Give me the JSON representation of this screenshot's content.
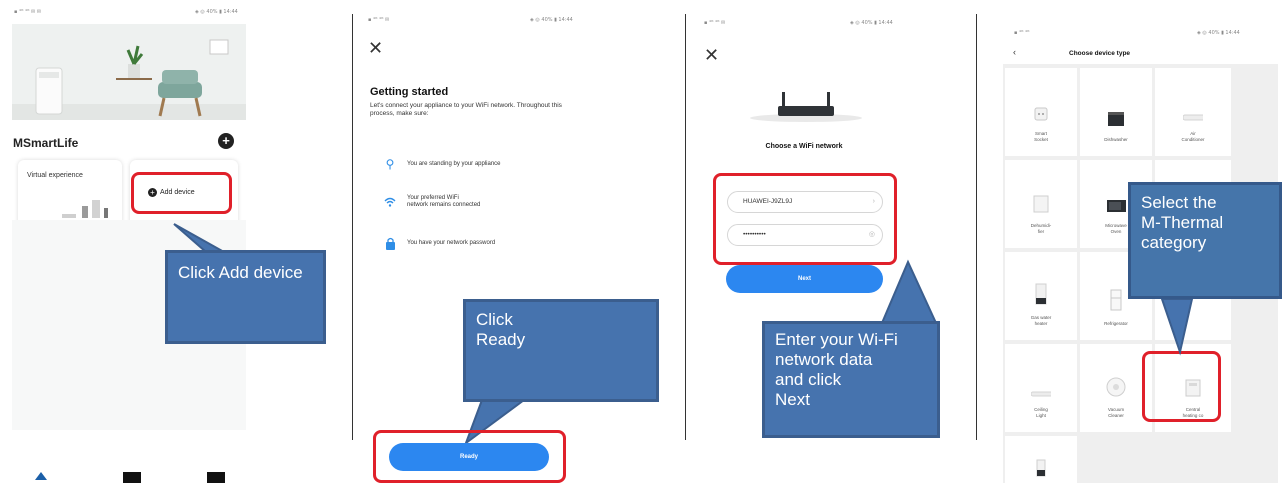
{
  "screen1": {
    "status_left": "▪ ⁴ᴳ ⁴ᴳ ✉ ✉",
    "status_right": "◈ ◎ 40% ▮ 14:44",
    "brand": "MSmartLife",
    "card_virtual": "Virtual experience",
    "add_device": "Add device",
    "callout": "Click Add device"
  },
  "screen2": {
    "status_left": "▪ ⁴ᴳ ⁴ᴳ ✉",
    "status_right": "◈ ◎ 40% ▮ 14:44",
    "close": "✕",
    "title": "Getting started",
    "description": "Let's connect your appliance to your WiFi network. Throughout this process, make sure:",
    "items": [
      {
        "icon": "person-pin-icon",
        "text": "You are standing by your appliance"
      },
      {
        "icon": "wifi-icon",
        "text": "Your preferred WiFi\nnetwork remains connected"
      },
      {
        "icon": "lock-icon",
        "text": "You have your network password"
      }
    ],
    "ready_button": "Ready",
    "callout": "Click\nReady"
  },
  "screen3": {
    "status_left": "▪ ⁴ᴳ ⁴ᴳ ✉",
    "status_right": "◈ ◎ 40% ▮ 14:44",
    "close": "✕",
    "title": "Choose a WiFi network",
    "network_name": "HUAWEI-J9ZL9J",
    "password": "••••••••••",
    "next_button": "Next",
    "callout": "Enter your Wi-Fi\nnetwork data\nand click\nNext"
  },
  "screen4": {
    "status_left": "▪ ⁴ᴳ ⁴ᴳ",
    "status_right": "◈ ◎ 40% ▮ 14:44",
    "back": "‹",
    "title": "Choose device type",
    "tiles": [
      {
        "label": "Smart\nSocket"
      },
      {
        "label": "Dishwasher"
      },
      {
        "label": "Air\nConditioner"
      },
      {
        "label": "Dehumidi-\nfier"
      },
      {
        "label": "Microwave\nOven"
      },
      {
        "label": ""
      },
      {
        "label": "Gas water\nheater"
      },
      {
        "label": "Refrigerator"
      },
      {
        "label": ""
      },
      {
        "label": "Ceiling\nLight"
      },
      {
        "label": "Vacuum\nCleaner"
      },
      {
        "label": "Central\nheating co"
      },
      {
        "label": ""
      }
    ],
    "callout": "Select the\nM-Thermal\ncategory"
  },
  "colors": {
    "callout_blue": "#4673ae",
    "highlight_red": "#e0202a",
    "button_blue": "#2c87f0"
  }
}
